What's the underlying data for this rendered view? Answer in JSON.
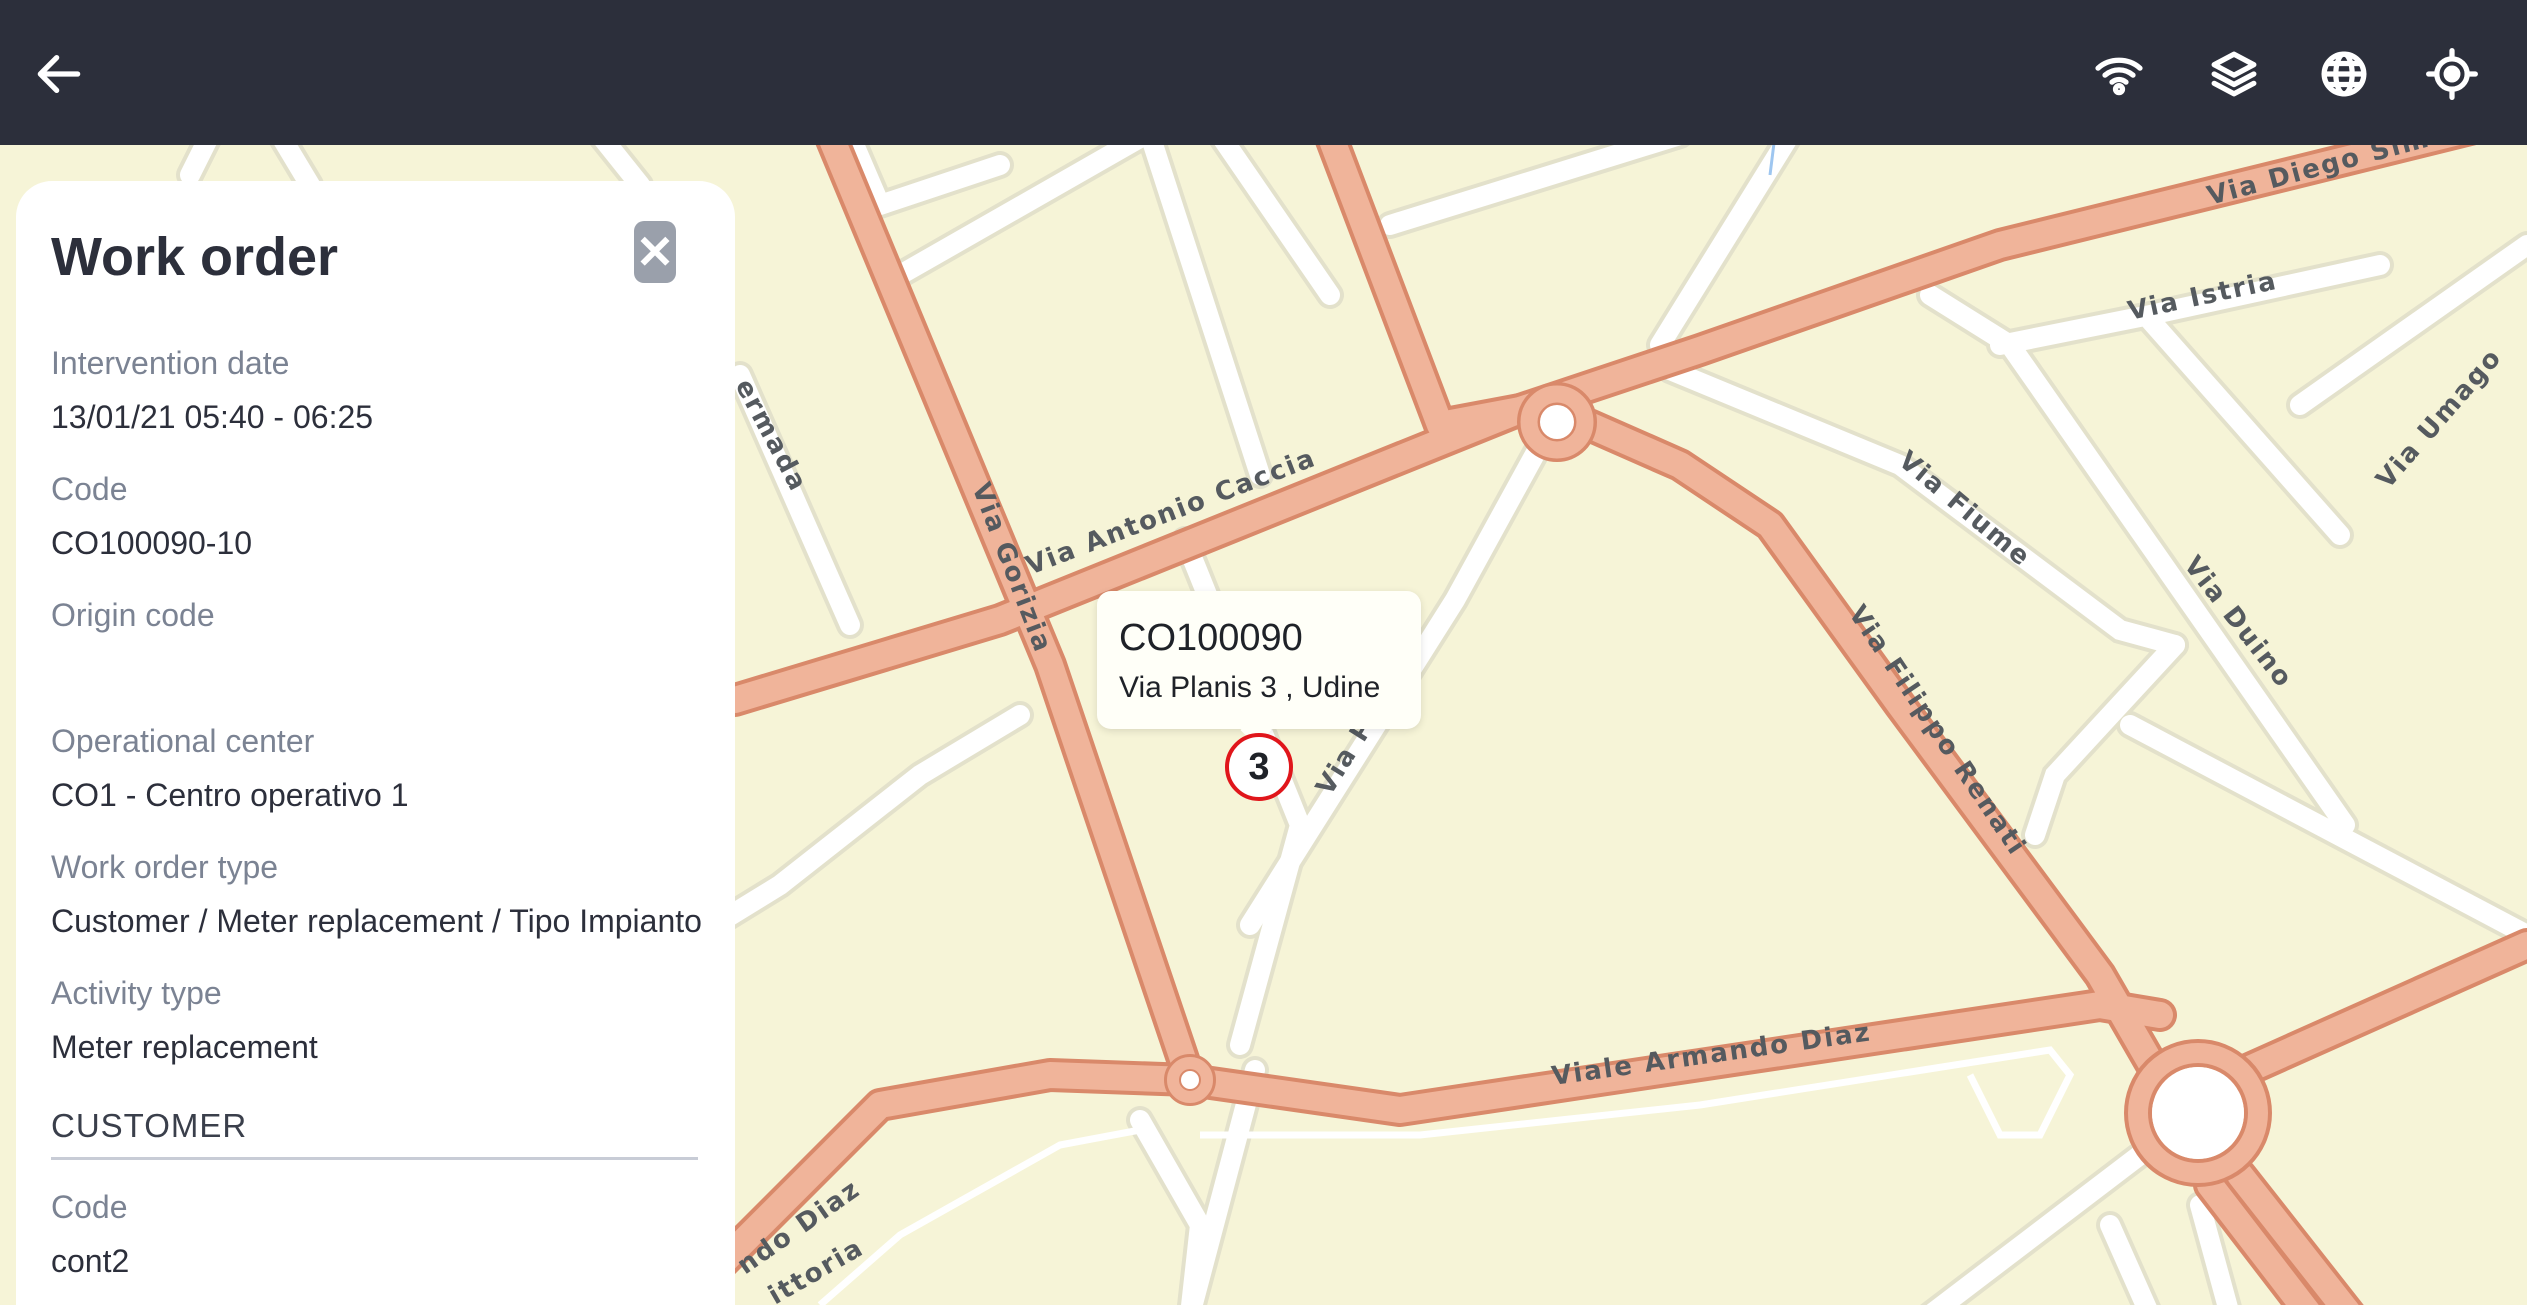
{
  "toolbar": {
    "back_icon": "arrow-left-icon",
    "wifi_icon": "wifi-icon",
    "layers_icon": "layers-icon",
    "globe_icon": "globe-icon",
    "locate_icon": "crosshair-icon"
  },
  "panel": {
    "title": "Work order",
    "close_icon": "close-icon",
    "fields": {
      "intervention_date": {
        "label": "Intervention date",
        "value": "13/01/21 05:40 - 06:25"
      },
      "code": {
        "label": "Code",
        "value": "CO100090-10"
      },
      "origin_code": {
        "label": "Origin code",
        "value": ""
      },
      "operational_center": {
        "label": "Operational center",
        "value": "CO1 - Centro operativo 1"
      },
      "work_order_type": {
        "label": "Work order type",
        "value": "Customer / Meter replacement / Tipo Impianto"
      },
      "activity_type": {
        "label": "Activity type",
        "value": "Meter replacement"
      }
    },
    "customer_section": {
      "title": "CUSTOMER",
      "code": {
        "label": "Code",
        "value": "cont2"
      }
    }
  },
  "map": {
    "popup": {
      "title": "CO100090",
      "address": "Via Planis 3 , Udine"
    },
    "marker_count": "3",
    "streets": {
      "via_diego": "Via Diego Simo",
      "via_istria": "Via Istria",
      "via_umago": "Via Umago",
      "via_fiume": "Via Fiume",
      "via_duino": "Via Duino",
      "via_filippo_renati": "Via Filippo Renati",
      "via_antonio_caccia": "Via Antonio Caccia",
      "via_gorizia": "Via Gorizia",
      "via_planis": "Via Planis",
      "viale_armando_diaz": "Viale Armando Diaz",
      "ndo_diaz": "ndo Diaz",
      "ermada": "ermada",
      "ittoria": "ittoria"
    },
    "colors": {
      "background": "#f6f4d7",
      "primary_road": "#f0b49a",
      "secondary_road": "#ffffff",
      "marker_ring": "#e0161b"
    }
  }
}
